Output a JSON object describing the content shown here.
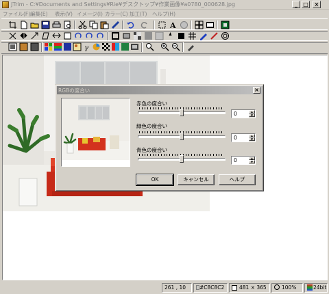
{
  "window": {
    "title": "JTrim - C:¥Documents and Settings¥Rie¥デスクトップ¥作業画像¥a0780_000628.jpg",
    "minimize": "_",
    "maximize": "□",
    "close": "×"
  },
  "menu": [
    "ファイル(F)",
    "編集(E)",
    "表示(V)",
    "イメージ(I)",
    "カラー(C)",
    "加工(T)",
    "ヘルプ(H)"
  ],
  "dialog": {
    "title": "RGBの度合い",
    "close": "×",
    "sliders": [
      {
        "label": "赤色の度合い",
        "value": "0",
        "position": 0.5
      },
      {
        "label": "緑色の度合い",
        "value": "0",
        "position": 0.5
      },
      {
        "label": "青色の度合い",
        "value": "0",
        "position": 0.5
      }
    ],
    "buttons": {
      "ok": "OK",
      "cancel": "キャンセル",
      "help": "ヘルプ"
    }
  },
  "status": {
    "coords": "261 , 10",
    "color": "#C8C8C2",
    "size": "481 × 365",
    "zoom": "100%",
    "depth": "24bit"
  }
}
